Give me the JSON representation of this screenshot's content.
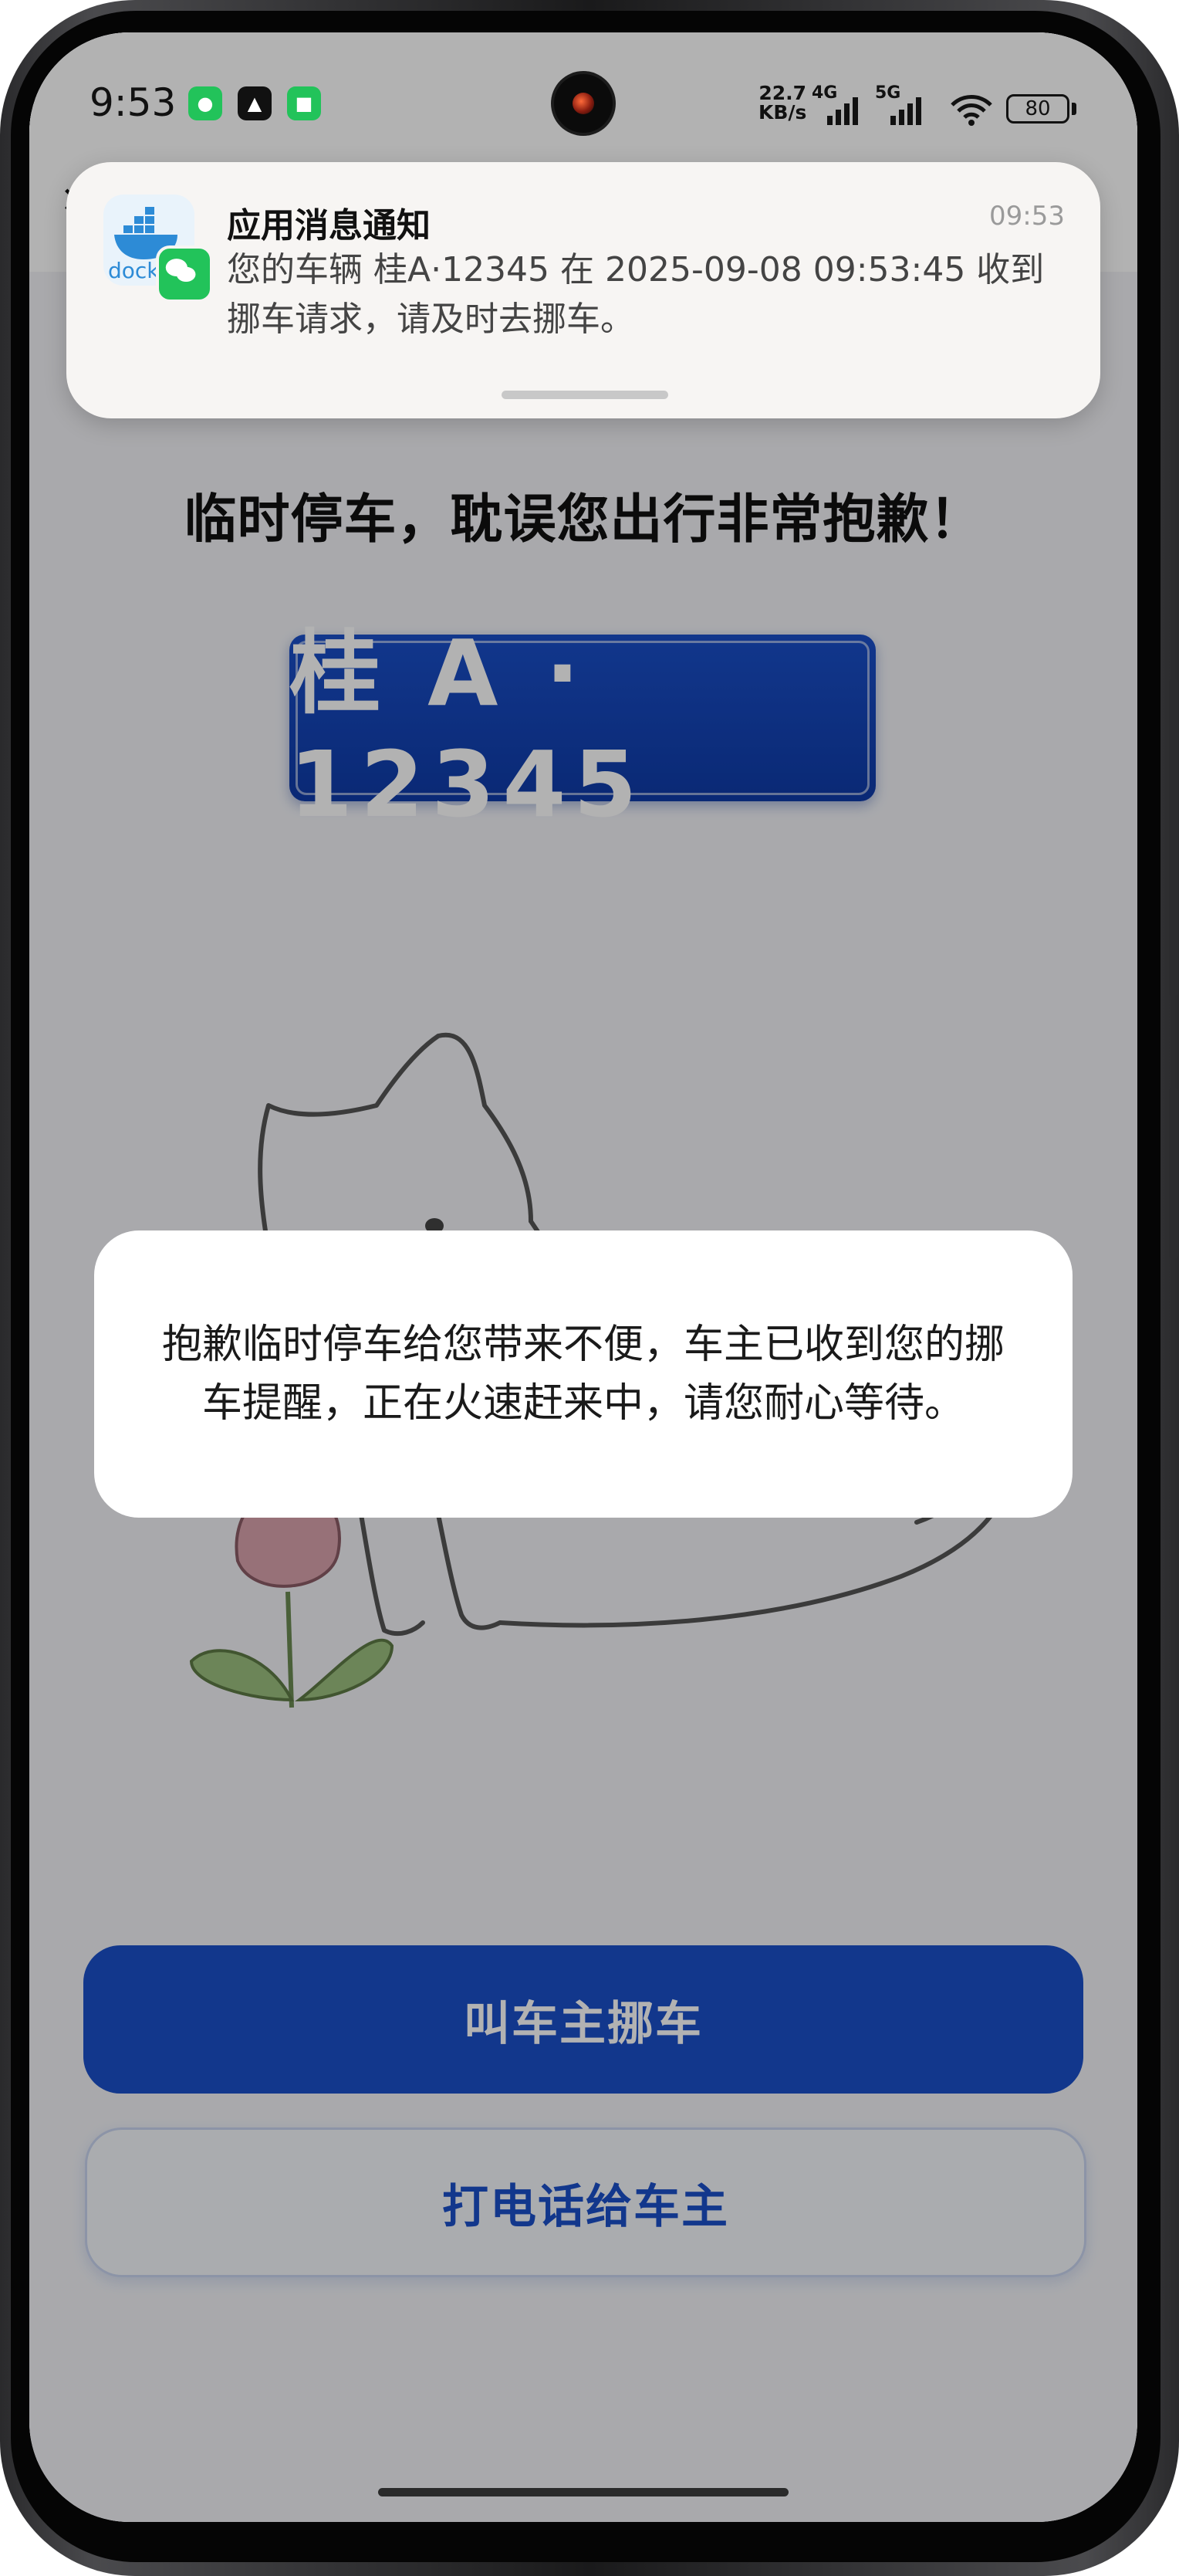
{
  "status_bar": {
    "time": "9:53",
    "network_rate_value": "22.7",
    "network_rate_unit": "KB/s",
    "sim1_type": "4G",
    "sim2_type": "5G",
    "battery": "80",
    "status_icons": [
      "wechat-icon",
      "vpn-icon",
      "mi-home-icon"
    ]
  },
  "notification": {
    "title": "应用消息通知",
    "time": "09:53",
    "body": "您的车辆 桂A·12345 在 2025-09-08 09:53:45 收到挪车请求，请及时去挪车。",
    "app_icon": "docker-icon",
    "badge_icon": "wechat-icon"
  },
  "page": {
    "title": "临时停车，耽误您出行非常抱歉！",
    "plate": "桂 A · 12345",
    "illustration": "cat-and-tulip-drawing",
    "primary_button": "叫车主挪车",
    "secondary_button": "打电话给车主"
  },
  "toast": {
    "message": "抱歉临时停车给您带来不便，车主已收到您的挪车提醒，正在火速赶来中，请您耐心等待。"
  },
  "colors": {
    "accent": "#1a4fc9",
    "overlay": "rgba(0,0,0,0.30)",
    "wechat_green": "#22c35a"
  }
}
